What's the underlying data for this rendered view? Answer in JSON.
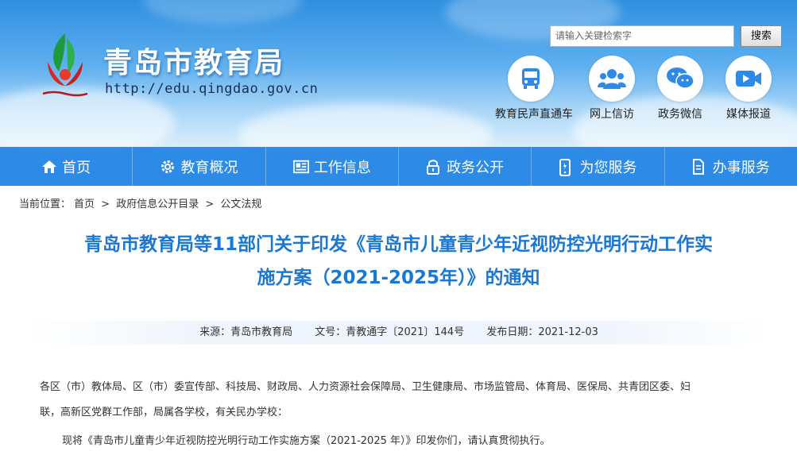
{
  "header": {
    "site_title": "青岛市教育局",
    "site_url": "http://edu.qingdao.gov.cn",
    "search_placeholder": "请输入关键检索字",
    "search_button": "搜索",
    "quick_links": [
      {
        "label": "教育民声直通车",
        "icon": "bus-icon"
      },
      {
        "label": "网上信访",
        "icon": "users-icon"
      },
      {
        "label": "政务微信",
        "icon": "wechat-icon"
      },
      {
        "label": "媒体报道",
        "icon": "video-icon"
      }
    ]
  },
  "nav": {
    "items": [
      {
        "label": "首页",
        "icon": "home-icon"
      },
      {
        "label": "教育概况",
        "icon": "gear-icon"
      },
      {
        "label": "工作信息",
        "icon": "newspaper-icon"
      },
      {
        "label": "政务公开",
        "icon": "lock-icon"
      },
      {
        "label": "为您服务",
        "icon": "phone-icon"
      },
      {
        "label": "办事服务",
        "icon": "document-icon"
      }
    ]
  },
  "breadcrumb": {
    "prefix": "当前位置：",
    "items": [
      "首页",
      "政府信息公开目录",
      "公文法规"
    ],
    "separator": ">"
  },
  "article": {
    "title_line1": "青岛市教育局等11部门关于印发《青岛市儿童青少年近视防控光明行动工作实",
    "title_line2": "施方案（2021-2025年）》的通知",
    "source": "来源：青岛市教育局",
    "doc_number": "文号：青教通字〔2021〕144号",
    "publish_date": "发布日期：2021-12-03",
    "paragraph1_line1": "各区（市）教体局、区（市）委宣传部、科技局、财政局、人力资源社会保障局、卫生健康局、市场监管局、体育局、医保局、共青团区委、妇",
    "paragraph1_line2": "联，高新区党群工作部，局属各学校，有关民办学校：",
    "paragraph2": "现将《青岛市儿童青少年近视防控光明行动工作实施方案（2021-2025 年）》印发你们，请认真贯彻执行。"
  },
  "colors": {
    "nav_bg": "#2d8ae6",
    "title_blue": "#1a78d4"
  }
}
